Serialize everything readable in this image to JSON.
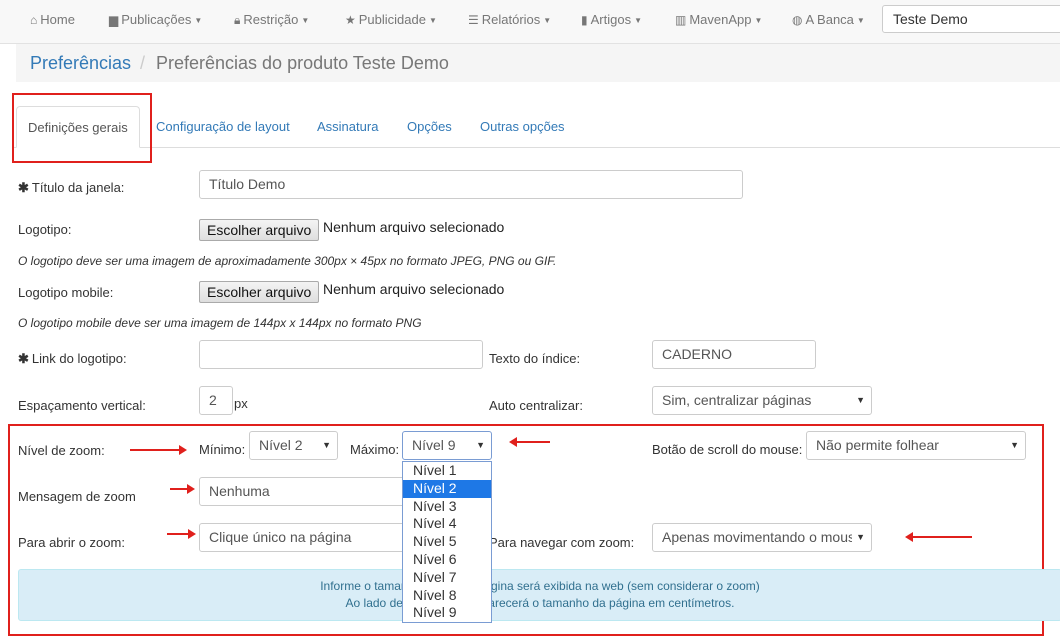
{
  "nav": {
    "items": [
      {
        "icon": "home-icon",
        "label": "Home",
        "dropdown": false
      },
      {
        "icon": "file-icon",
        "label": "Publicações",
        "dropdown": true
      },
      {
        "icon": "lock-icon",
        "label": "Restrição",
        "dropdown": true
      },
      {
        "icon": "star-icon",
        "label": "Publicidade",
        "dropdown": true
      },
      {
        "icon": "list-icon",
        "label": "Relatórios",
        "dropdown": true
      },
      {
        "icon": "bookmark-icon",
        "label": "Artigos",
        "dropdown": true
      },
      {
        "icon": "barcode-icon",
        "label": "MavenApp",
        "dropdown": true
      },
      {
        "icon": "globe-icon",
        "label": "A Banca",
        "dropdown": true
      }
    ],
    "search_value": "Teste Demo"
  },
  "breadcrumb": {
    "root": "Preferências",
    "separator": "/",
    "current": "Preferências do produto Teste Demo"
  },
  "tabs": [
    {
      "label": "Definições gerais",
      "active": true
    },
    {
      "label": "Configuração de layout",
      "active": false
    },
    {
      "label": "Assinatura",
      "active": false
    },
    {
      "label": "Opções",
      "active": false
    },
    {
      "label": "Outras opções",
      "active": false
    }
  ],
  "form": {
    "title_label": "Título da janela:",
    "title_value": "Título Demo",
    "required_mark": "✱",
    "logo_label": "Logotipo:",
    "file_button": "Escolher arquivo",
    "no_file": "Nenhum arquivo selecionado",
    "logo_help": "O logotipo deve ser uma imagem de aproximadamente 300px × 45px no formato JPEG, PNG ou GIF.",
    "logo_mobile_label": "Logotipo mobile:",
    "logo_mobile_help": "O logotipo mobile deve ser uma imagem de 144px x 144px no formato PNG",
    "logo_link_label": "Link do logotipo:",
    "logo_link_value": "",
    "index_text_label": "Texto do índice:",
    "index_text_value": "CADERNO",
    "vertical_spacing_label": "Espaçamento vertical:",
    "vertical_spacing_value": "2",
    "vertical_spacing_unit": "px",
    "auto_center_label": "Auto centralizar:",
    "auto_center_value": "Sim, centralizar páginas",
    "zoom_level_label": "Nível de zoom:",
    "min_label": "Mínimo:",
    "min_value": "Nível 2",
    "max_label": "Máximo:",
    "max_value": "Nível 9",
    "scroll_label": "Botão de scroll do mouse:",
    "scroll_value": "Não permite folhear",
    "zoom_msg_label": "Mensagem de zoom",
    "zoom_msg_value": "Nenhuma",
    "open_zoom_label": "Para abrir o zoom:",
    "open_zoom_value": "Clique único na página",
    "navigate_zoom_label": "Para navegar com zoom:",
    "navigate_zoom_value": "Apenas movimentando o mouse"
  },
  "dropdown": {
    "options": [
      "Nível 1",
      "Nível 2",
      "Nível 3",
      "Nível 4",
      "Nível 5",
      "Nível 6",
      "Nível 7",
      "Nível 8",
      "Nível 9"
    ],
    "highlighted_index": 1
  },
  "info": {
    "line1": "Informe o tamanho em que a página será exibida na web (sem considerar o zoom)",
    "line2": "Ao lado de cada campo aparecerá o tamanho da página em centímetros."
  },
  "colors": {
    "link": "#337ab7",
    "annotation": "#e0201c",
    "highlight": "#1e78e6",
    "info_bg": "#d9edf7"
  }
}
